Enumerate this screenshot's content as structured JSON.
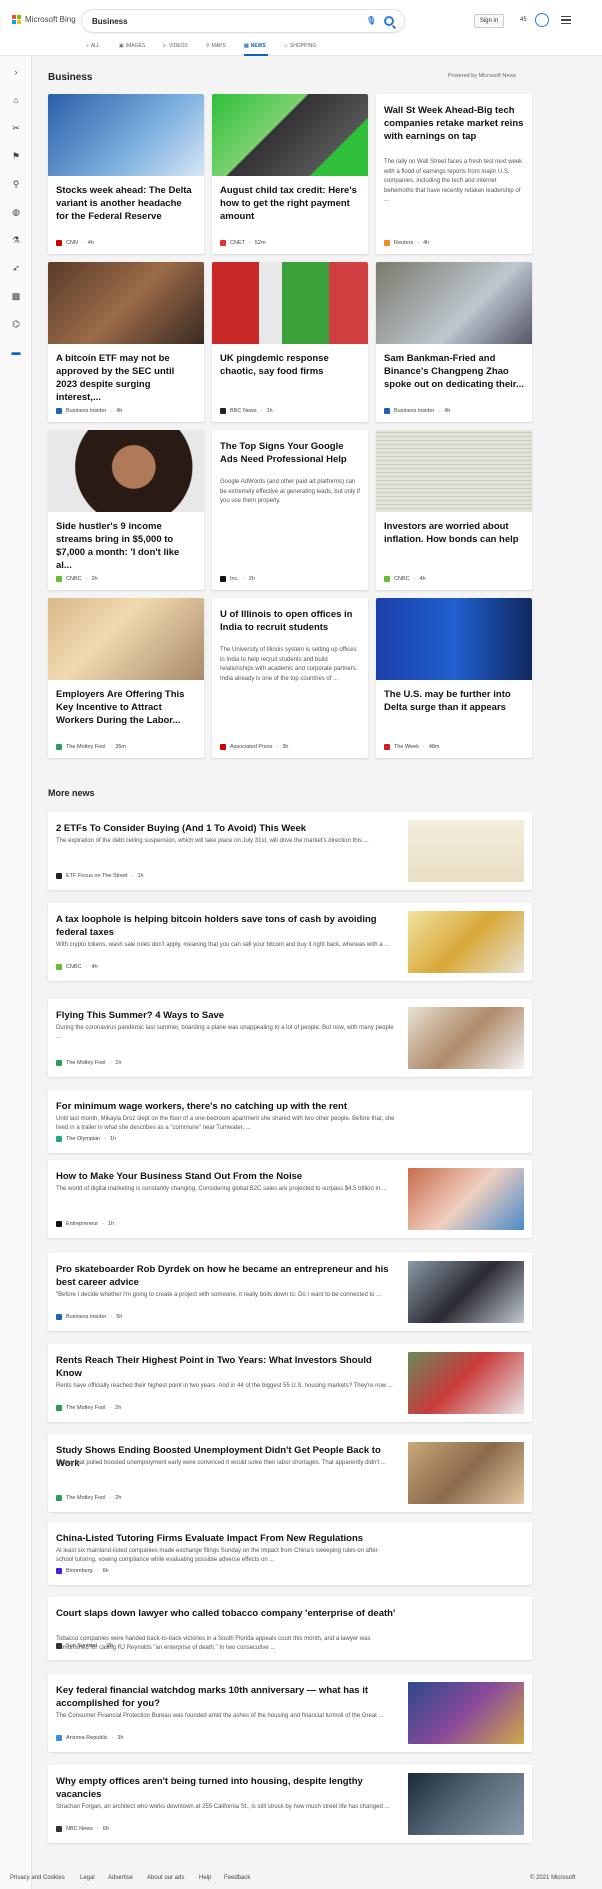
{
  "header": {
    "brand": "Microsoft Bing",
    "query": "Business",
    "signin": "Sign in",
    "points": "45"
  },
  "nav": {
    "all": "ALL",
    "images": "IMAGES",
    "videos": "VIDEOS",
    "maps": "MAPS",
    "news": "NEWS",
    "shopping": "SHOPPING"
  },
  "section": {
    "title": "Business",
    "powered": "Powered by Microsoft News"
  },
  "cards": [
    {
      "title": "Stocks week ahead: The Delta variant is another headache for the Federal Reserve",
      "source": "CNN",
      "age": "4h",
      "color": "#cc0000"
    },
    {
      "title": "August child tax credit: Here's how to get the right payment amount",
      "source": "CNET",
      "age": "52m",
      "color": "#d33"
    },
    {
      "title": "Wall St Week Ahead-Big tech companies retake market reins with earnings on tap",
      "snippet": "The rally on Wall Street faces a fresh test next week with a flood of earnings reports from major U.S. companies, including the tech and internet behemoths that have recently retaken leadership of ...",
      "source": "Reuters",
      "age": "4h",
      "color": "#f28c28"
    },
    {
      "title": "A bitcoin ETF may not be approved by the SEC until 2023 despite surging interest,...",
      "source": "Business Insider",
      "age": "4h",
      "color": "#1f5fbf"
    },
    {
      "title": "UK pingdemic response chaotic, say food firms",
      "source": "BBC News",
      "age": "1h",
      "color": "#222"
    },
    {
      "title": "Sam Bankman-Fried and Binance's Changpeng Zhao spoke out on dedicating their...",
      "source": "Business Insider",
      "age": "4h",
      "color": "#1f5fbf"
    },
    {
      "title": "Side hustler's 9 income streams bring in $5,000 to $7,000 a month: 'I don't like al...",
      "source": "CNBC",
      "age": "2h",
      "color": "#6b3"
    },
    {
      "title": "The Top Signs Your Google Ads Need Professional Help",
      "snippet": "Google AdWords (and other paid ad platforms) can be extremely effective at generating leads, but only if you use them properly.",
      "source": "Inc.",
      "age": "2h",
      "color": "#111"
    },
    {
      "title": "Investors are worried about inflation. How bonds can help",
      "source": "CNBC",
      "age": "4h",
      "color": "#6b3"
    },
    {
      "title": "Employers Are Offering This Key Incentive to Attract Workers During the Labor...",
      "source": "The Motley Fool",
      "age": "35m",
      "color": "#2a9d5c"
    },
    {
      "title": "U of Illinois to open offices in India to recruit students",
      "snippet": "The University of Illinois system is setting up offices in India to help recruit students and build relationships with academic and corporate partners. India already is one of the top countries of ...",
      "source": "Associated Press",
      "age": "3h",
      "color": "#c00"
    },
    {
      "title": "The U.S. may be further into Delta surge than it appears",
      "source": "The Week",
      "age": "48m",
      "color": "#c22"
    }
  ],
  "more": {
    "title": "More news"
  },
  "rows": [
    {
      "title": "2 ETFs To Consider Buying (And 1 To Avoid) This Week",
      "snippet": "The expiration of the debt ceiling suspension, which will take place on July 31st, will drive the market's direction this ...",
      "source": "ETF Focus on The Street",
      "age": "1h",
      "color": "#222"
    },
    {
      "title": "A tax loophole is helping bitcoin holders save tons of cash by avoiding federal taxes",
      "snippet": "With crypto tokens, wash sale rules don't apply, meaning that you can sell your bitcoin and buy it right back, whereas with a ...",
      "source": "CNBC",
      "age": "4h",
      "color": "#6b3"
    },
    {
      "title": "Flying This Summer? 4 Ways to Save",
      "snippet": "During the coronavirus pandemic last summer, boarding a plane was unappealing to a lot of people. But now, with many people ...",
      "source": "The Motley Fool",
      "age": "1h",
      "color": "#2a9d5c"
    },
    {
      "title": "For minimum wage workers, there's no catching up with the rent",
      "snippet": "Until last month, Mikayla Droz slept on the floor of a one-bedroom apartment she shared with two other people. Before that, she lived in a trailer in what she describes as a \"commune\" near Tumwater, ...",
      "source": "The Olympian",
      "age": "1h",
      "color": "#2a7"
    },
    {
      "title": "How to Make Your Business Stand Out From the Noise",
      "snippet": "The world of digital marketing is constantly changing. Considering global B2C sales are projected to surpass $4.5 trillion in ...",
      "source": "Entrepreneur",
      "age": "1h",
      "color": "#111"
    },
    {
      "title": "Pro skateboarder Rob Dyrdek on how he became an entrepreneur and his best career advice",
      "snippet": "\"Before I decide whether I'm going to create a project with someone, it really boils down to: Do I want to be connected to ...",
      "source": "Business Insider",
      "age": "5h",
      "color": "#1f5fbf"
    },
    {
      "title": "Rents Reach Their Highest Point in Two Years: What Investors Should Know",
      "snippet": "Rents have officially reached their highest point in two years. And in 44 of the biggest 55 U.S. housing markets? They're now ...",
      "source": "The Motley Fool",
      "age": "2h",
      "color": "#2a9d5c"
    },
    {
      "title": "Study Shows Ending Boosted Unemployment Didn't Get People Back to Work",
      "snippet": "States that pulled boosted unemployment early were convinced it would solve their labor shortages. That apparently didn't ...",
      "source": "The Motley Fool",
      "age": "2h",
      "color": "#2a9d5c"
    },
    {
      "title": "China-Listed Tutoring Firms Evaluate Impact From New Regulations",
      "snippet": "At least six mainland-listed companies made exchange filings Sunday on the impact from China's sweeping rules on after-school tutoring, vowing compliance while evaluating possible adverse effects on ...",
      "source": "Bloomberg",
      "age": "6h",
      "color": "#4b1fd6"
    },
    {
      "title": "Court slaps down lawyer who called tobacco company 'enterprise of death'",
      "snippet": "Tobacco companies were handed back-to-back victories in a South Florida appeals court this month, and a lawyer was admonished for calling RJ Reynolds \"an enterprise of death.\" In two consecutive ...",
      "source": "Sun Sentinel",
      "age": "2h",
      "color": "#333"
    },
    {
      "title": "Key federal financial watchdog marks 10th anniversary — what has it accomplished for you?",
      "snippet": "The Consumer Financial Protection Bureau was founded amid the ashes of the housing and financial turmoil of the Great ...",
      "source": "Arizona Republic",
      "age": "3h",
      "color": "#3a8fd6"
    },
    {
      "title": "Why empty offices aren't being turned into housing, despite lengthy vacancies",
      "snippet": "Strachan Forgan, an architect who works downtown at 255 California St., is still struck by how much street life has changed ...",
      "source": "NBC News",
      "age": "6h",
      "color": "#333"
    }
  ],
  "footer": {
    "privacy": "Privacy and Cookies",
    "legal": "Legal",
    "advertise": "Advertise",
    "about": "About our ads",
    "help": "Help",
    "feedback": "Feedback",
    "copyright": "© 2021 Microsoft"
  }
}
